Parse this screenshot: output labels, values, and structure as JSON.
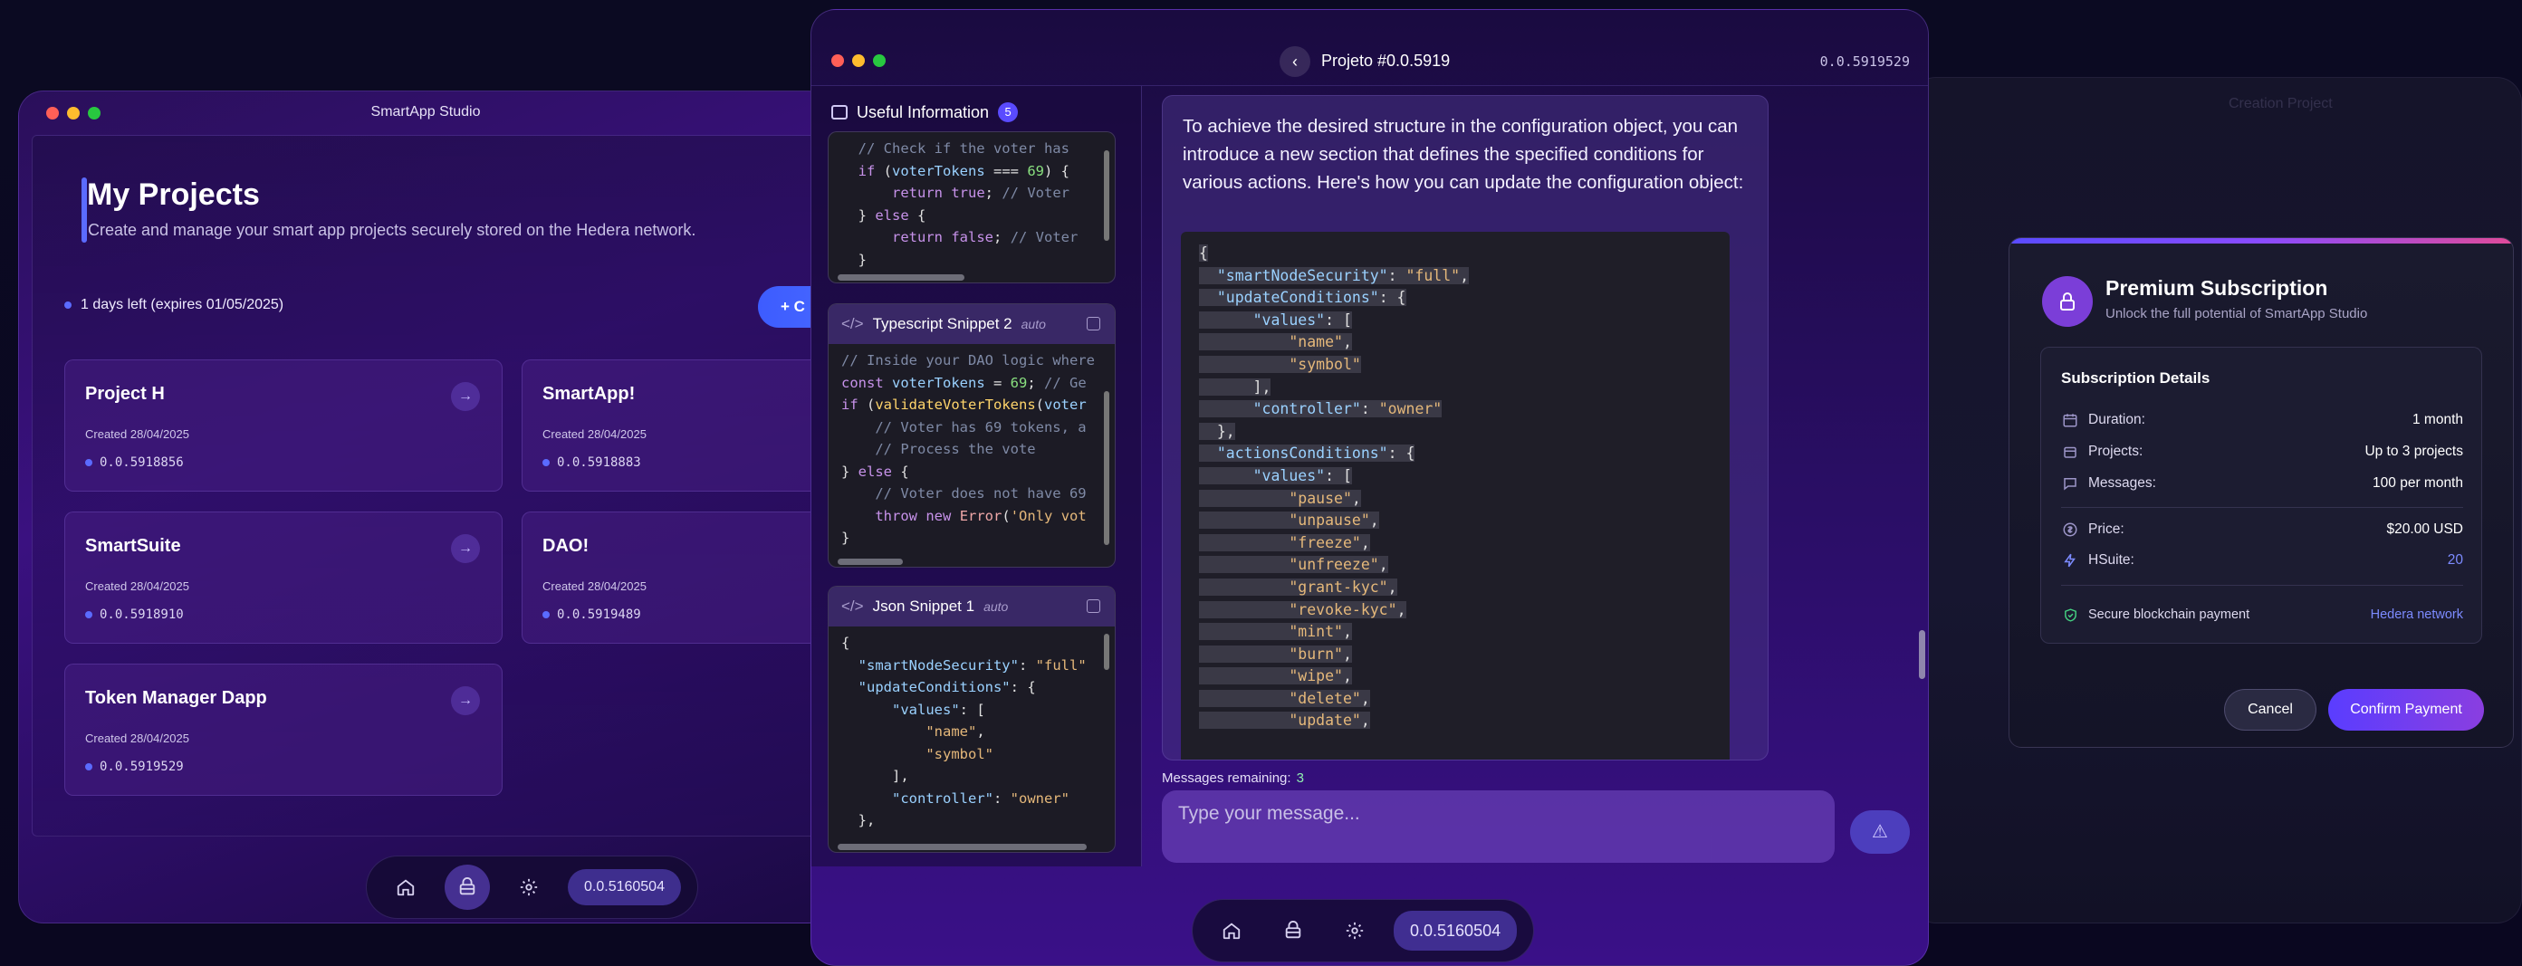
{
  "left_window": {
    "title": "SmartApp Studio",
    "heading": "My Projects",
    "subheading": "Create and manage your smart app projects securely stored on the Hedera network.",
    "days_left": "1 days left (expires 01/05/2025)",
    "new_button": "+ C",
    "projects": [
      {
        "name": "Project H",
        "created": "Created 28/04/2025",
        "id": "0.0.5918856"
      },
      {
        "name": "SmartApp!",
        "created": "Created 28/04/2025",
        "id": "0.0.5918883"
      },
      {
        "name": "SmartSuite",
        "created": "Created 28/04/2025",
        "id": "0.0.5918910"
      },
      {
        "name": "DAO!",
        "created": "Created 28/04/2025",
        "id": "0.0.5919489"
      },
      {
        "name": "Token Manager Dapp",
        "created": "Created 28/04/2025",
        "id": "0.0.5919529"
      }
    ],
    "dock_account": "0.0.5160504"
  },
  "mid_window": {
    "title": "Projeto #0.0.5919",
    "version": "0.0.5919529",
    "info_title": "Useful Information",
    "info_count": "5",
    "snippet2_title": "Typescript Snippet 2",
    "snippet3_title": "Json Snippet 1",
    "auto_label": "auto",
    "assistant_message": "To achieve the desired structure in the configuration object, you can introduce a new section that defines the specified conditions for various actions. Here's how you can update the configuration object:",
    "messages_remaining_label": "Messages remaining:",
    "messages_remaining_value": "3",
    "input_placeholder": "Type your message...",
    "dock_account": "0.0.5160504"
  },
  "modal": {
    "title": "Premium Subscription",
    "subtitle": "Unlock the full potential of SmartApp Studio",
    "details_title": "Subscription Details",
    "rows": [
      {
        "label": "Duration:",
        "value": "1 month"
      },
      {
        "label": "Projects:",
        "value": "Up to 3 projects"
      },
      {
        "label": "Messages:",
        "value": "100 per month"
      },
      {
        "label": "Price:",
        "value": "$20.00 USD"
      },
      {
        "label": "HSuite:",
        "value": "20"
      }
    ],
    "secure_label": "Secure blockchain payment",
    "network_label": "Hedera network",
    "cancel": "Cancel",
    "confirm": "Confirm Payment"
  },
  "colors": {
    "accent": "#5b6bff",
    "purple": "#7b3ed8"
  }
}
